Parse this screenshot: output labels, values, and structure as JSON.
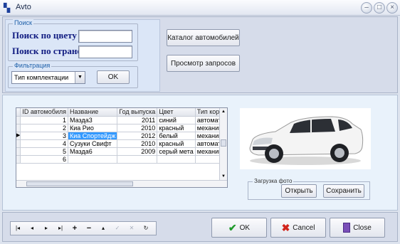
{
  "window": {
    "title": "Avto",
    "minimize_label": "–",
    "restore_label": "□",
    "close_label": "×"
  },
  "search": {
    "group_title": "Поиск",
    "by_color_label": "Поиск по цвету",
    "by_country_label": "Поиск по стране",
    "color_value": "",
    "country_value": ""
  },
  "filter": {
    "group_title": "Фильтрация",
    "selected": "Тип комплектации",
    "ok_label": "OK"
  },
  "buttons": {
    "catalog_label": "Каталог автомобилей",
    "queries_label": "Просмотр запросов"
  },
  "grid": {
    "columns": [
      "ID автомобиля",
      "Название",
      "Год выпуска",
      "Цвет",
      "Тип короб"
    ],
    "rows": [
      {
        "id": "1",
        "name": "Мазда3",
        "year": "2011",
        "color": "синий",
        "gearbox": "автомат"
      },
      {
        "id": "2",
        "name": "Киа Рио",
        "year": "2010",
        "color": "красный",
        "gearbox": "механика"
      },
      {
        "id": "3",
        "name": "Киа Спортейдж",
        "year": "2012",
        "color": "белый",
        "gearbox": "механика"
      },
      {
        "id": "4",
        "name": "Сузуки Свифт",
        "year": "2010",
        "color": "красный",
        "gearbox": "автомат"
      },
      {
        "id": "5",
        "name": "Мазда6",
        "year": "2009",
        "color": "серый мета",
        "gearbox": "механика"
      },
      {
        "id": "6",
        "name": "",
        "year": "",
        "color": "",
        "gearbox": ""
      }
    ],
    "current_row_marker": "▶"
  },
  "photo": {
    "group_title": "Загрузка фото",
    "open_label": "Открыть",
    "save_label": "Сохранить"
  },
  "navigator": [
    {
      "icon": "first-record-icon",
      "glyph": "|◂",
      "enabled": true
    },
    {
      "icon": "prior-record-icon",
      "glyph": "◂",
      "enabled": true
    },
    {
      "icon": "next-record-icon",
      "glyph": "▸",
      "enabled": true
    },
    {
      "icon": "last-record-icon",
      "glyph": "▸|",
      "enabled": true
    },
    {
      "icon": "insert-record-icon",
      "glyph": "+",
      "enabled": true
    },
    {
      "icon": "delete-record-icon",
      "glyph": "−",
      "enabled": true
    },
    {
      "icon": "edit-record-icon",
      "glyph": "▴",
      "enabled": true
    },
    {
      "icon": "post-edit-icon",
      "glyph": "✓",
      "enabled": false
    },
    {
      "icon": "cancel-edit-icon",
      "glyph": "✕",
      "enabled": false
    },
    {
      "icon": "refresh-icon",
      "glyph": "↻",
      "enabled": true
    }
  ],
  "footer": {
    "ok_label": "OK",
    "cancel_label": "Cancel",
    "close_label": "Close"
  },
  "colors": {
    "ok_check": "#1f9a2b",
    "cancel_x": "#d1241c",
    "close_door": "#7a4fb8",
    "selection": "#3399ff"
  }
}
